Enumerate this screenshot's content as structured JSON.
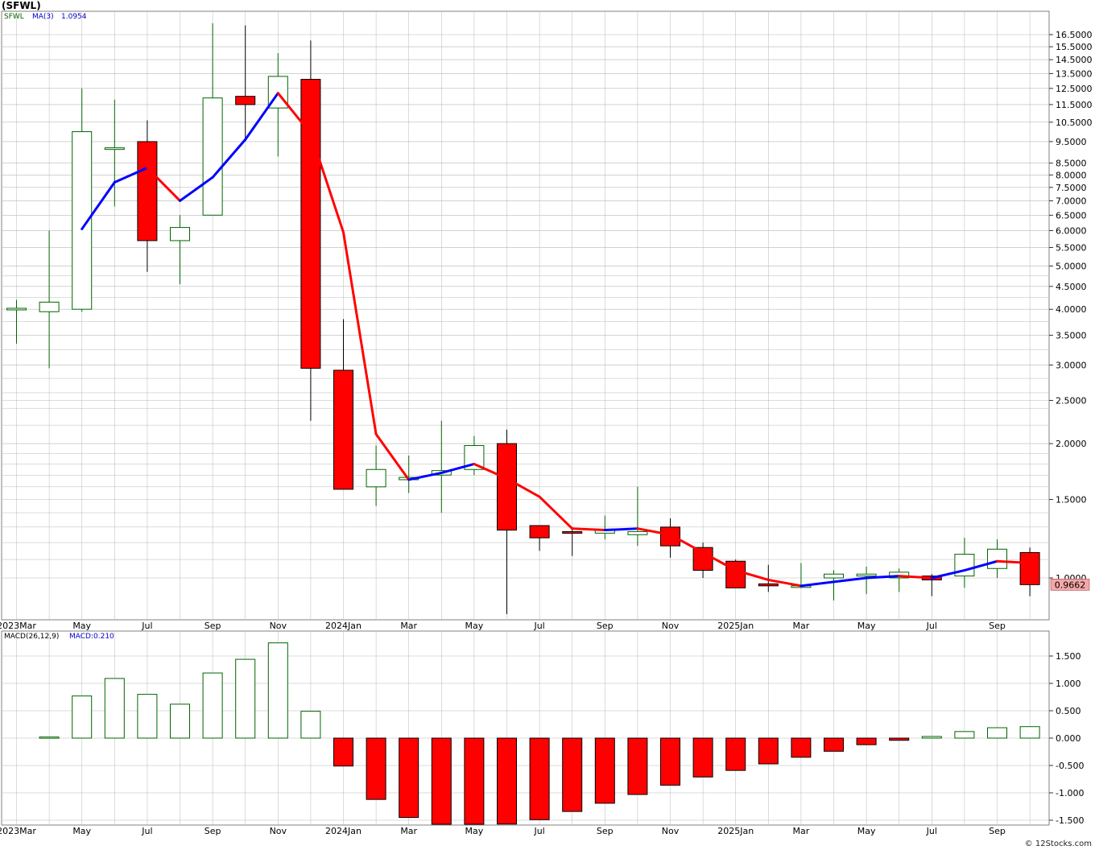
{
  "title": "(SFWL)",
  "legend_price": {
    "symbol": "SFWL",
    "ma_label": "MA(3)",
    "ma_value": "1.0954"
  },
  "legend_macd": {
    "label": "MACD(26,12,9)",
    "value": "MACD:0.210"
  },
  "last_price_label": "0.9662",
  "credit": "© 12Stocks.com",
  "colors": {
    "up_outline": "#006400",
    "down_fill": "#ff0000",
    "ma_up": "#0000ff",
    "ma_down": "#ff0000",
    "grid": "#b8b8b8",
    "last_price_bg": "#f4a7a7"
  },
  "chart_data": [
    {
      "type": "candlestick",
      "title": "(SFWL)",
      "scale": "log",
      "ylim": [
        0.75,
        18.5
      ],
      "x_ticks": [
        "2023Mar",
        "May",
        "Jul",
        "Sep",
        "Nov",
        "2024Jan",
        "Mar",
        "May",
        "Jul",
        "Sep",
        "Nov",
        "2025Jan",
        "Mar",
        "May",
        "Jul",
        "Sep"
      ],
      "y_ticks": [
        "16.5000",
        "15.5000",
        "14.5000",
        "13.5000",
        "12.5000",
        "11.5000",
        "10.5000",
        "9.5000",
        "8.5000",
        "8.0000",
        "7.5000",
        "7.0000",
        "6.5000",
        "6.0000",
        "5.5000",
        "5.0000",
        "4.5000",
        "4.0000",
        "3.5000",
        "3.0000",
        "2.5000",
        "2.0000",
        "1.5000",
        "1.0000"
      ],
      "candles": [
        {
          "date": "2023-03",
          "open": 4.0,
          "high": 4.2,
          "low": 3.35,
          "close": 4.02
        },
        {
          "date": "2023-04",
          "open": 3.95,
          "high": 6.0,
          "low": 2.95,
          "close": 4.15
        },
        {
          "date": "2023-05",
          "open": 4.0,
          "high": 12.5,
          "low": 3.95,
          "close": 10.0
        },
        {
          "date": "2023-06",
          "open": 9.2,
          "high": 11.8,
          "low": 6.8,
          "close": 9.2
        },
        {
          "date": "2023-07",
          "open": 9.5,
          "high": 10.6,
          "low": 4.85,
          "close": 5.7
        },
        {
          "date": "2023-08",
          "open": 5.7,
          "high": 6.5,
          "low": 4.55,
          "close": 6.1
        },
        {
          "date": "2023-09",
          "open": 6.5,
          "high": 17.5,
          "low": 6.5,
          "close": 11.9
        },
        {
          "date": "2023-10",
          "open": 12.0,
          "high": 17.3,
          "low": 9.5,
          "close": 11.5
        },
        {
          "date": "2023-11",
          "open": 11.3,
          "high": 15.0,
          "low": 8.8,
          "close": 13.3
        },
        {
          "date": "2023-12",
          "open": 13.1,
          "high": 16.0,
          "low": 2.25,
          "close": 2.95
        },
        {
          "date": "2024-01",
          "open": 2.92,
          "high": 3.8,
          "low": 1.58,
          "close": 1.58
        },
        {
          "date": "2024-02",
          "open": 1.6,
          "high": 1.98,
          "low": 1.45,
          "close": 1.75
        },
        {
          "date": "2024-03",
          "open": 1.66,
          "high": 1.88,
          "low": 1.55,
          "close": 1.68
        },
        {
          "date": "2024-04",
          "open": 1.7,
          "high": 2.25,
          "low": 1.4,
          "close": 1.74
        },
        {
          "date": "2024-05",
          "open": 1.75,
          "high": 2.08,
          "low": 1.7,
          "close": 1.98
        },
        {
          "date": "2024-06",
          "open": 2.0,
          "high": 2.15,
          "low": 0.83,
          "close": 1.28
        },
        {
          "date": "2024-07",
          "open": 1.31,
          "high": 1.31,
          "low": 1.15,
          "close": 1.23
        },
        {
          "date": "2024-08",
          "open": 1.27,
          "high": 1.3,
          "low": 1.12,
          "close": 1.26
        },
        {
          "date": "2024-09",
          "open": 1.26,
          "high": 1.38,
          "low": 1.22,
          "close": 1.28
        },
        {
          "date": "2024-10",
          "open": 1.25,
          "high": 1.6,
          "low": 1.18,
          "close": 1.27
        },
        {
          "date": "2024-11",
          "open": 1.3,
          "high": 1.36,
          "low": 1.11,
          "close": 1.18
        },
        {
          "date": "2024-12",
          "open": 1.17,
          "high": 1.2,
          "low": 1.0,
          "close": 1.04
        },
        {
          "date": "2025-01",
          "open": 1.09,
          "high": 1.1,
          "low": 0.95,
          "close": 0.95
        },
        {
          "date": "2025-02",
          "open": 0.97,
          "high": 1.07,
          "low": 0.93,
          "close": 0.96
        },
        {
          "date": "2025-03",
          "open": 0.96,
          "high": 1.08,
          "low": 0.95,
          "close": 0.96
        },
        {
          "date": "2025-04",
          "open": 1.0,
          "high": 1.04,
          "low": 0.89,
          "close": 1.02
        },
        {
          "date": "2025-05",
          "open": 1.01,
          "high": 1.06,
          "low": 0.92,
          "close": 1.02
        },
        {
          "date": "2025-06",
          "open": 1.0,
          "high": 1.05,
          "low": 0.93,
          "close": 1.03
        },
        {
          "date": "2025-07",
          "open": 1.01,
          "high": 1.02,
          "low": 0.91,
          "close": 0.99
        },
        {
          "date": "2025-08",
          "open": 1.01,
          "high": 1.23,
          "low": 0.95,
          "close": 1.13
        },
        {
          "date": "2025-09",
          "open": 1.05,
          "high": 1.22,
          "low": 1.0,
          "close": 1.16
        },
        {
          "date": "2025-10",
          "open": 1.14,
          "high": 1.17,
          "low": 0.91,
          "close": 0.966
        }
      ],
      "ma": {
        "name": "MA(3)",
        "values": [
          null,
          null,
          6.05,
          7.7,
          8.3,
          7.0,
          7.9,
          9.6,
          12.2,
          9.9,
          5.95,
          2.1,
          1.66,
          1.72,
          1.8,
          1.67,
          1.52,
          1.29,
          1.28,
          1.29,
          1.25,
          1.14,
          1.04,
          0.99,
          0.96,
          0.98,
          1.0,
          1.01,
          1.0,
          1.04,
          1.09,
          1.08
        ]
      }
    },
    {
      "type": "bar",
      "title": "MACD(26,12,9)",
      "ylim": [
        -1.6,
        1.85
      ],
      "y_ticks": [
        "1.500",
        "1.000",
        "0.500",
        "0.000",
        "-0.500",
        "-1.000",
        "-1.500"
      ],
      "x_ticks": [
        "2023Mar",
        "May",
        "Jul",
        "Sep",
        "Nov",
        "2024Jan",
        "Mar",
        "May",
        "Jul",
        "Sep",
        "Nov",
        "2025Jan",
        "Mar",
        "May",
        "Jul",
        "Sep"
      ],
      "values": [
        0,
        0.02,
        0.77,
        1.09,
        0.8,
        0.62,
        1.19,
        1.44,
        1.74,
        0.49,
        -0.51,
        -1.12,
        -1.45,
        -1.6,
        -1.58,
        -1.57,
        -1.49,
        -1.34,
        -1.19,
        -1.03,
        -0.86,
        -0.71,
        -0.59,
        -0.47,
        -0.35,
        -0.24,
        -0.12,
        -0.04,
        0.03,
        0.12,
        0.19,
        0.21
      ]
    }
  ]
}
